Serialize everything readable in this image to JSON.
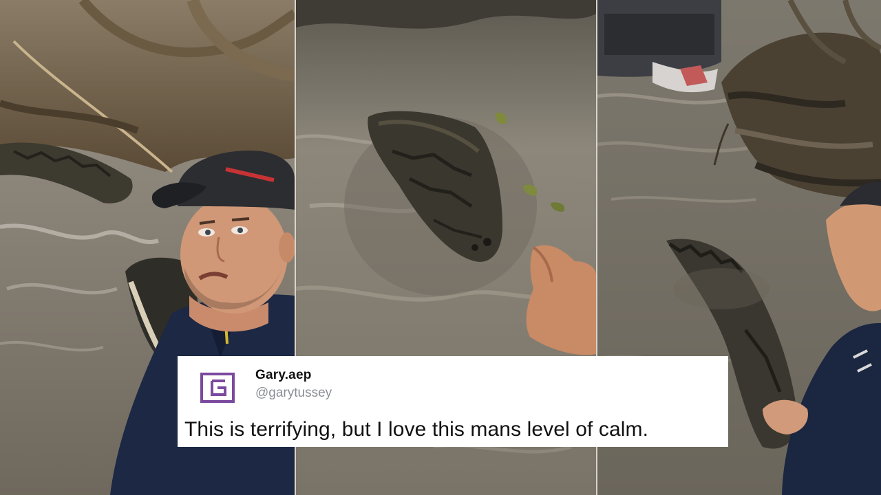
{
  "tweet": {
    "display_name": "Gary.aep",
    "handle": "@garytussey",
    "text": "This is terrifying, but I love this mans level of calm.",
    "avatar_icon": "logo-icon",
    "avatar_color": "#7b4a9e"
  },
  "panels": [
    {
      "description_icon": "man-with-crocodile-photo"
    },
    {
      "description_icon": "crocodile-in-water-photo"
    },
    {
      "description_icon": "crocodile-near-riverbank-photo"
    }
  ]
}
